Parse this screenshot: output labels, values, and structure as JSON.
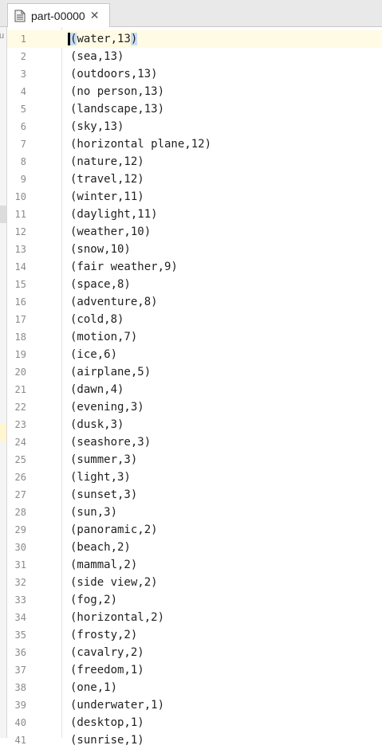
{
  "tab": {
    "title": "part-00000",
    "close_glyph": "✕",
    "icon": "file-icon"
  },
  "left_strip_char": "u",
  "lines": [
    {
      "num": "1",
      "text": "(water,13)"
    },
    {
      "num": "2",
      "text": "(sea,13)"
    },
    {
      "num": "3",
      "text": "(outdoors,13)"
    },
    {
      "num": "4",
      "text": "(no person,13)"
    },
    {
      "num": "5",
      "text": "(landscape,13)"
    },
    {
      "num": "6",
      "text": "(sky,13)"
    },
    {
      "num": "7",
      "text": "(horizontal plane,12)"
    },
    {
      "num": "8",
      "text": "(nature,12)"
    },
    {
      "num": "9",
      "text": "(travel,12)"
    },
    {
      "num": "10",
      "text": "(winter,11)"
    },
    {
      "num": "11",
      "text": "(daylight,11)"
    },
    {
      "num": "12",
      "text": "(weather,10)"
    },
    {
      "num": "13",
      "text": "(snow,10)"
    },
    {
      "num": "14",
      "text": "(fair weather,9)"
    },
    {
      "num": "15",
      "text": "(space,8)"
    },
    {
      "num": "16",
      "text": "(adventure,8)"
    },
    {
      "num": "17",
      "text": "(cold,8)"
    },
    {
      "num": "18",
      "text": "(motion,7)"
    },
    {
      "num": "19",
      "text": "(ice,6)"
    },
    {
      "num": "20",
      "text": "(airplane,5)"
    },
    {
      "num": "21",
      "text": "(dawn,4)"
    },
    {
      "num": "22",
      "text": "(evening,3)"
    },
    {
      "num": "23",
      "text": "(dusk,3)"
    },
    {
      "num": "24",
      "text": "(seashore,3)"
    },
    {
      "num": "25",
      "text": "(summer,3)"
    },
    {
      "num": "26",
      "text": "(light,3)"
    },
    {
      "num": "27",
      "text": "(sunset,3)"
    },
    {
      "num": "28",
      "text": "(sun,3)"
    },
    {
      "num": "29",
      "text": "(panoramic,2)"
    },
    {
      "num": "30",
      "text": "(beach,2)"
    },
    {
      "num": "31",
      "text": "(mammal,2)"
    },
    {
      "num": "32",
      "text": "(side view,2)"
    },
    {
      "num": "33",
      "text": "(fog,2)"
    },
    {
      "num": "34",
      "text": "(horizontal,2)"
    },
    {
      "num": "35",
      "text": "(frosty,2)"
    },
    {
      "num": "36",
      "text": "(cavalry,2)"
    },
    {
      "num": "37",
      "text": "(freedom,1)"
    },
    {
      "num": "38",
      "text": "(one,1)"
    },
    {
      "num": "39",
      "text": "(underwater,1)"
    },
    {
      "num": "40",
      "text": "(desktop,1)"
    },
    {
      "num": "41",
      "text": "(sunrise,1)"
    }
  ],
  "colors": {
    "current_line": "#fffbe4",
    "bracket_match": "#c7dcf5",
    "line_number": "#8a8a8a"
  }
}
